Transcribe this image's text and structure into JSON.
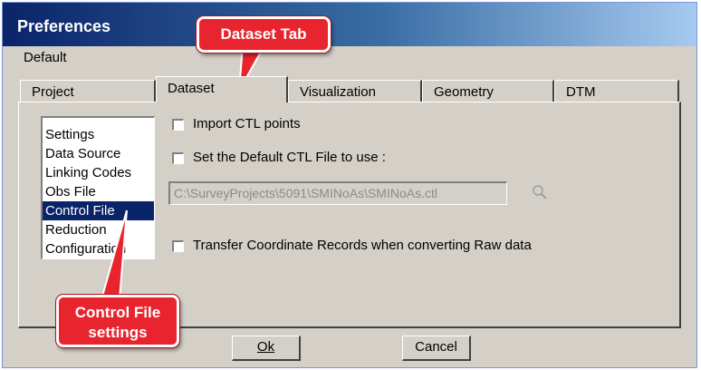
{
  "window": {
    "title": "Preferences"
  },
  "menu": {
    "default_label": "Default"
  },
  "tabs": [
    "Project",
    "Dataset",
    "Visualization",
    "Geometry",
    "DTM"
  ],
  "list": {
    "items": [
      "Settings",
      "Data Source",
      "Linking Codes",
      "Obs File",
      "Control File",
      "Reduction",
      "Configuration"
    ],
    "selected": "Control File"
  },
  "options": {
    "import_ctl": {
      "label": "Import CTL points",
      "checked": false
    },
    "default_ctl": {
      "label": "Set the Default CTL File to use :",
      "checked": false
    },
    "ctl_path": "C:\\SurveyProjects\\5091\\SMINoAs\\SMINoAs.ctl",
    "transfer": {
      "label": "Transfer Coordinate Records when converting Raw data",
      "checked": false
    }
  },
  "buttons": {
    "ok": "Ok",
    "cancel": "Cancel"
  },
  "callouts": {
    "tab": "Dataset Tab",
    "control_file_line1": "Control File",
    "control_file_line2": "settings"
  },
  "icons": {
    "browse": "magnifier-icon"
  },
  "colors": {
    "callout": "#e8252f",
    "selection": "#0a246a"
  }
}
